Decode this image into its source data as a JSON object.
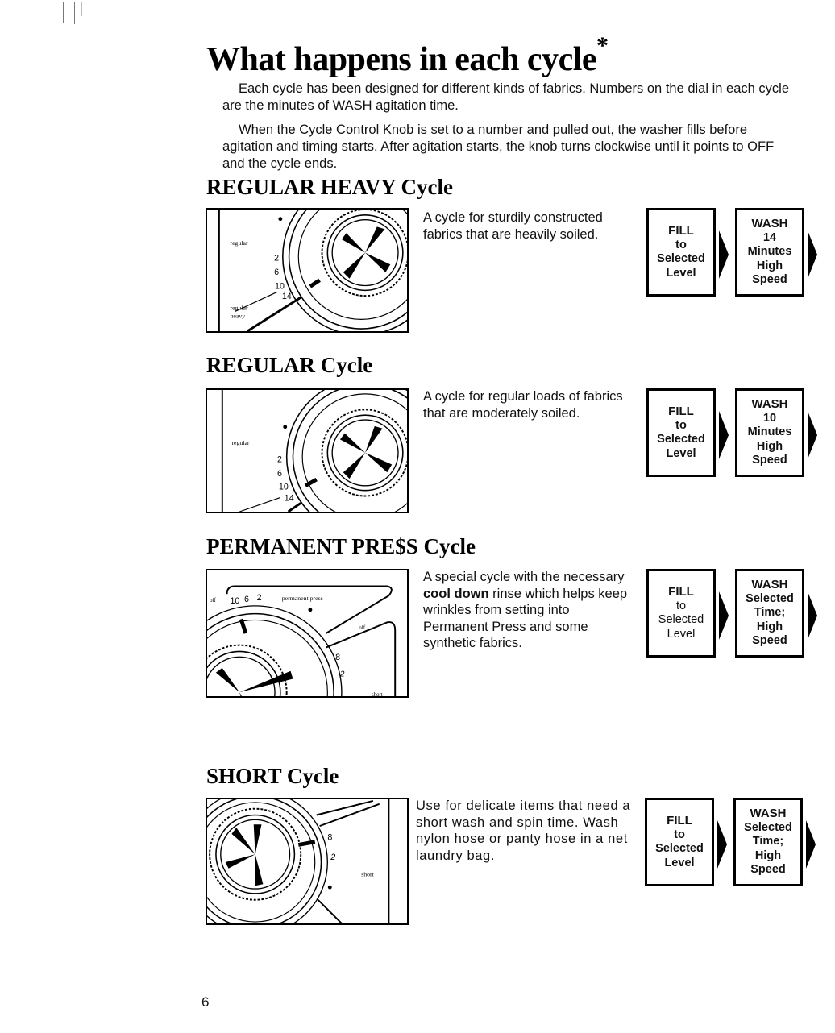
{
  "title": "What happens in each cycle",
  "title_asterisk": "*",
  "intro": {
    "p1": "Each cycle has been designed for different kinds of fabrics. Numbers on the dial in each cycle are the minutes of WASH agitation time.",
    "p2": "When the Cycle Control Knob is set to a number and pulled out, the washer fills before agitation and timing starts. After agitation starts, the knob turns clockwise until it points to OFF and the cycle ends."
  },
  "cycles": [
    {
      "title": "REGULAR HEAVY Cycle",
      "description": "A cycle for sturdily constructed fabrics that are heavily soiled.",
      "dial": {
        "label_top": "regular",
        "label_bottom": "regular heavy",
        "marks": [
          "2",
          "6",
          "10",
          "14"
        ]
      },
      "fill": {
        "head": "FILL",
        "lines": [
          "to",
          "Selected",
          "Level"
        ]
      },
      "wash": {
        "head": "WASH",
        "lines": [
          "14",
          "Minutes",
          "High",
          "Speed"
        ]
      }
    },
    {
      "title": "REGULAR Cycle",
      "description": "A cycle for regular loads of fabrics that are moderately soiled.",
      "dial": {
        "label_top": "regular",
        "marks": [
          "2",
          "6",
          "10",
          "14"
        ]
      },
      "fill": {
        "head": "FILL",
        "lines": [
          "to",
          "Selected",
          "Level"
        ]
      },
      "wash": {
        "head": "WASH",
        "lines": [
          "10",
          "Minutes",
          "High",
          "Speed"
        ]
      }
    },
    {
      "title": "PERMANENT PRE$S Cycle",
      "description_before": "A special cycle with the necessary ",
      "description_bold": "cool down",
      "description_after": " rinse which helps keep wrinkles from setting into Permanent Press and some synthetic fabrics.",
      "dial": {
        "label_top": "permanent press",
        "label_off_left": "off",
        "label_off_right": "off",
        "label_bottom": "short",
        "marks": [
          "10",
          "6",
          "2"
        ],
        "marks_short": [
          "8",
          "2"
        ]
      },
      "fill": {
        "head": "FILL",
        "lines": [
          "to",
          "Selected",
          "Level"
        ]
      },
      "wash": {
        "head": "WASH",
        "lines": [
          "Selected",
          "Time;",
          "High",
          "Speed"
        ]
      }
    },
    {
      "title": "SHORT Cycle",
      "description": "Use for delicate items that need a short wash and spin time. Wash nylon hose or panty hose in a net laundry bag.",
      "dial": {
        "label": "short",
        "marks": [
          "8",
          "2"
        ]
      },
      "fill": {
        "head": "FILL",
        "lines": [
          "to",
          "Selected",
          "Level"
        ]
      },
      "wash": {
        "head": "WASH",
        "lines": [
          "Selected",
          "Time;",
          "High",
          "Speed"
        ]
      }
    }
  ],
  "page_number": "6"
}
